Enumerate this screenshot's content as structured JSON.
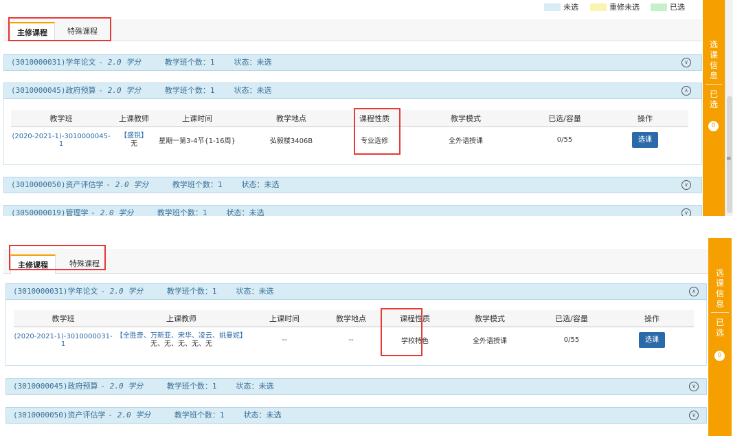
{
  "legend": [
    {
      "label": "未选",
      "color": "#d8ecf6"
    },
    {
      "label": "重修未选",
      "color": "#fbf3b0"
    },
    {
      "label": "已选",
      "color": "#c8f0c8"
    }
  ],
  "tabs": [
    {
      "label": "主修课程",
      "active": true
    },
    {
      "label": "特殊课程",
      "active": false
    }
  ],
  "sidebar": {
    "info": "选课信息",
    "selected": "已选",
    "count": "0"
  },
  "table_headers_1": [
    "教学班",
    "上课教师",
    "上课时间",
    "教学地点",
    "课程性质",
    "教学模式",
    "已选/容量",
    "操作"
  ],
  "table_headers_2": [
    "教学班",
    "上课教师",
    "上课时间",
    "教学地点",
    "课程性质",
    "教学模式",
    "已选/容量",
    "操作"
  ],
  "panel1": {
    "course1": {
      "title": "(3010000031)学年论文",
      "credits": "- 2.0 学分",
      "count": "教学班个数：1",
      "status": "状态：未选"
    },
    "course2": {
      "title": "(3010000045)政府预算",
      "credits": "- 2.0 学分",
      "count": "教学班个数：1",
      "status": "状态：未选"
    },
    "row": {
      "cls": "(2020-2021-1)-3010000045-1",
      "teacher": "【盛锐】",
      "teacher_sub": "无",
      "time": "星期一第3-4节{1-16周}",
      "place": "弘毅楼3406B",
      "nature": "专业选修",
      "mode": "全外语授课",
      "capacity": "0/55",
      "action": "选课"
    },
    "course3": {
      "title": "(3010000050)资产评估学",
      "credits": "- 2.0 学分",
      "count": "教学班个数：1",
      "status": "状态：未选"
    },
    "course4": {
      "title": "(3050000019)管理学",
      "credits": "- 2.0 学分",
      "count": "教学班个数：1",
      "status": "状态：未选"
    }
  },
  "panel2": {
    "course1": {
      "title": "(3010000031)学年论文",
      "credits": "- 2.0 学分",
      "count": "教学班个数：1",
      "status": "状态：未选"
    },
    "row": {
      "cls": "(2020-2021-1)-3010000031-1",
      "teacher": "【全胜奇、万新亚、宋华、凌云、姚曼妮】",
      "teacher_sub": "无、无、无、无、无",
      "time": "--",
      "place": "--",
      "nature": "学校特色",
      "mode": "全外语授课",
      "capacity": "0/55",
      "action": "选课"
    },
    "course2": {
      "title": "(3010000045)政府预算",
      "credits": "- 2.0 学分",
      "count": "教学班个数：1",
      "status": "状态：未选"
    },
    "course3": {
      "title": "(3010000050)资产评估学",
      "credits": "- 2.0 学分",
      "count": "教学班个数：1",
      "status": "状态：未选"
    }
  }
}
